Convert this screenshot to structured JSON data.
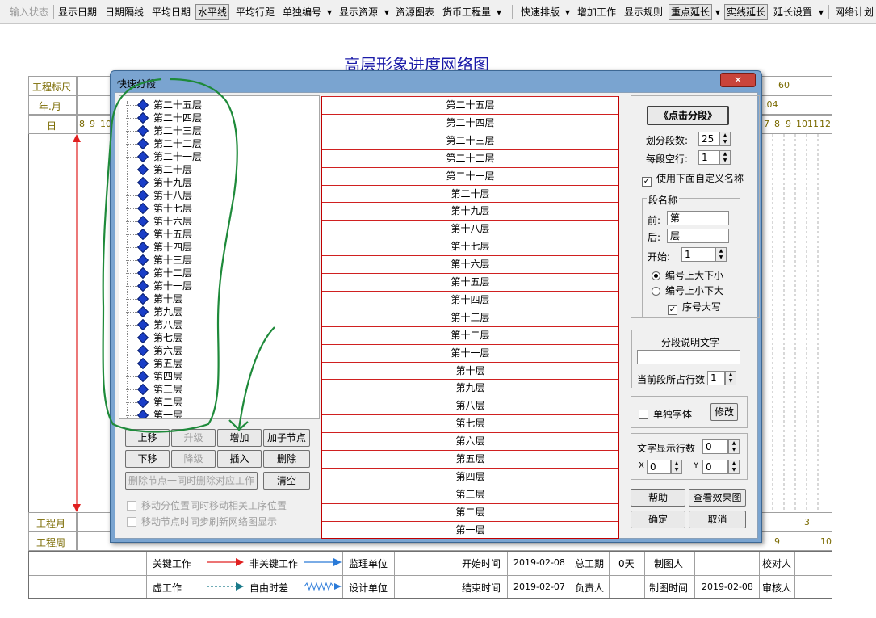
{
  "toolbar": {
    "items": [
      "输入状态",
      "显示日期",
      "日期隔线",
      "平均日期",
      "水平线",
      "平均行距",
      "单独编号",
      "显示资源",
      "资源图表",
      "货币工程量",
      "快速排版",
      "增加工作",
      "显示规则",
      "重点延长",
      "实线延长",
      "延长设置",
      "网络计划"
    ],
    "dropdown_glyph": "▾"
  },
  "chart": {
    "title": "高层形象进度网络图",
    "rows": {
      "ruler": "工程标尺",
      "month": "年.月",
      "day": "日",
      "eng_month": "工程月",
      "eng_week": "工程周"
    },
    "ruler_value": "60",
    "month_value": ".04",
    "day_left": [
      "8",
      "9",
      "10"
    ],
    "day_right": [
      "7",
      "8",
      "9",
      "10",
      "11",
      "12"
    ],
    "eng_month_value": "3",
    "eng_week_values": [
      "9",
      "10"
    ]
  },
  "dialog": {
    "title": "快速分段",
    "close_label": "✕",
    "tree_items": [
      "第二十五层",
      "第二十四层",
      "第二十三层",
      "第二十二层",
      "第二十一层",
      "第二十层",
      "第十九层",
      "第十八层",
      "第十七层",
      "第十六层",
      "第十五层",
      "第十四层",
      "第十三层",
      "第十二层",
      "第十一层",
      "第十层",
      "第九层",
      "第八层",
      "第七层",
      "第六层",
      "第五层",
      "第四层",
      "第三层",
      "第二层",
      "第一层"
    ],
    "list_items": [
      "第二十五层",
      "第二十四层",
      "第二十三层",
      "第二十二层",
      "第二十一层",
      "第二十层",
      "第十九层",
      "第十八层",
      "第十七层",
      "第十六层",
      "第十五层",
      "第十四层",
      "第十三层",
      "第十二层",
      "第十一层",
      "第十层",
      "第九层",
      "第八层",
      "第七层",
      "第六层",
      "第五层",
      "第四层",
      "第三层",
      "第二层",
      "第一层"
    ],
    "buttons": {
      "up": "上移",
      "promote": "升级",
      "add": "增加",
      "add_child": "加子节点",
      "down": "下移",
      "demote": "降级",
      "insert": "插入",
      "delete": "删除",
      "delete_node_with_work": "删除节点一同时删除对应工作",
      "clear": "清空"
    },
    "checkboxes": {
      "move_seg_sync": "移动分位置同时移动相关工序位置",
      "move_refresh": "移动节点时同步刷新网络图显示"
    },
    "right": {
      "click_segment": "《点击分段》",
      "seg_count_label": "划分段数:",
      "seg_count_value": "25",
      "blank_rows_label": "每段空行:",
      "blank_rows_value": "1",
      "use_custom_name": "使用下面自定义名称",
      "seg_name_group": "段名称",
      "prefix_label": "前:",
      "prefix_value": "第",
      "suffix_label": "后:",
      "suffix_value": "层",
      "start_label": "开始:",
      "start_value": "1",
      "order_big_top": "编号上大下小",
      "order_small_top": "编号上小下大",
      "uppercase": "序号大写",
      "desc_group": "分段说明文字",
      "desc_value": "",
      "rows_label": "当前段所占行数",
      "rows_value": "1",
      "single_font": "单独字体",
      "modify": "修改",
      "text_rows_label": "文字显示行数",
      "text_rows_value": "0",
      "x_label": "X",
      "x_value": "0",
      "y_label": "Y",
      "y_value": "0",
      "help": "帮助",
      "preview": "查看效果图",
      "ok": "确定",
      "cancel": "取消"
    }
  },
  "legend": {
    "critical": "关键工作",
    "noncritical": "非关键工作",
    "supervisor": "监理单位",
    "start_time_label": "开始时间",
    "start_time": "2019-02-08",
    "total_period_label": "总工期",
    "total_period": "0天",
    "drawer_label": "制图人",
    "checker_label": "校对人",
    "virtual": "虚工作",
    "free_float": "自由时差",
    "designer": "设计单位",
    "end_time_label": "结束时间",
    "end_time": "2019-02-07",
    "leader_label": "负责人",
    "draw_time_label": "制图时间",
    "draw_time": "2019-02-08",
    "reviewer_label": "审核人"
  },
  "colors": {
    "title_blue": "#1a1aa8",
    "critical_red": "#e02020",
    "noncritical_blue": "#2a7ad8",
    "free_float_blue": "#2a7ad8",
    "virtual_teal": "#1a7a8a",
    "annotation_green": "#1e8a3a"
  }
}
